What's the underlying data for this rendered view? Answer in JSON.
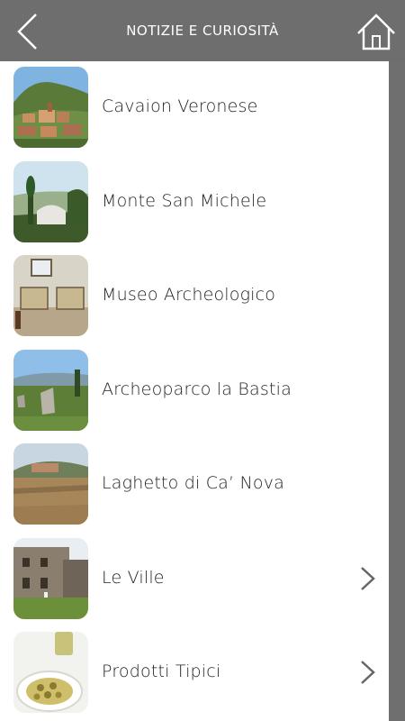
{
  "header": {
    "title": "NOTIZIE E CURIOSITÀ",
    "back_icon": "chevron-left-icon",
    "home_icon": "home-icon",
    "background": "#6e6e6e"
  },
  "items": [
    {
      "label": "Cavaion Veronese",
      "thumb": "cavaion-veronese-photo",
      "has_chevron": false
    },
    {
      "label": "Monte San Michele",
      "thumb": "monte-san-michele-photo",
      "has_chevron": false
    },
    {
      "label": "Museo Archeologico",
      "thumb": "museo-archeologico-photo",
      "has_chevron": false
    },
    {
      "label": "Archeoparco la Bastia",
      "thumb": "archeoparco-la-bastia-photo",
      "has_chevron": false
    },
    {
      "label": "Laghetto di Ca’ Nova",
      "thumb": "laghetto-ca-nova-photo",
      "has_chevron": false
    },
    {
      "label": "Le Ville",
      "thumb": "le-ville-photo",
      "has_chevron": true
    },
    {
      "label": "Prodotti Tipici",
      "thumb": "prodotti-tipici-photo",
      "has_chevron": true
    }
  ]
}
